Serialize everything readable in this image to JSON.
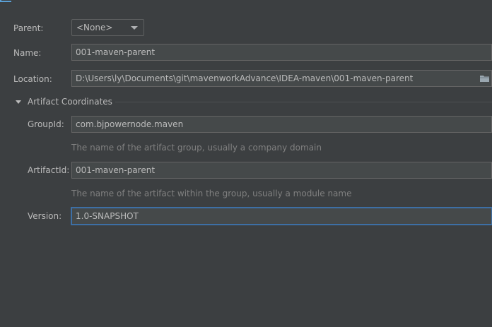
{
  "form": {
    "parent": {
      "label": "Parent:",
      "value": "<None>"
    },
    "name": {
      "label": "Name:",
      "value": "001-maven-parent"
    },
    "location": {
      "label": "Location:",
      "value": "D:\\Users\\ly\\Documents\\git\\mavenworkAdvance\\IDEA-maven\\001-maven-parent",
      "icon": "folder-icon"
    },
    "artifact_section": {
      "title": "Artifact Coordinates",
      "expanded": true
    },
    "group_id": {
      "label": "GroupId:",
      "value": "com.bjpowernode.maven",
      "hint": "The name of the artifact group, usually a company domain"
    },
    "artifact_id": {
      "label": "ArtifactId:",
      "value": "001-maven-parent",
      "hint": "The name of the artifact within the group, usually a module name"
    },
    "version": {
      "label": "Version:",
      "value": "1.0-SNAPSHOT",
      "focused": true
    }
  },
  "colors": {
    "background": "#3c3f41",
    "field_background": "#45494a",
    "field_border": "#646464",
    "focus_border": "#3d6fa5",
    "text": "#bbbbbb",
    "hint_text": "#808080"
  }
}
